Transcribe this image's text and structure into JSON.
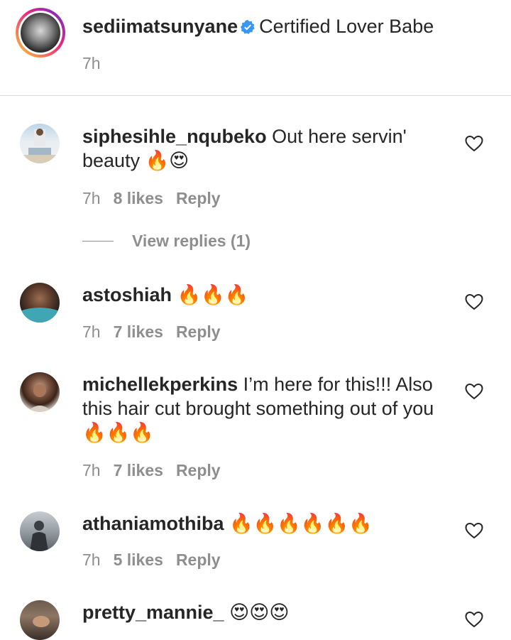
{
  "caption": {
    "username": "sediimatsunyane",
    "verified": true,
    "text": "Certified Lover Babe",
    "time": "7h"
  },
  "comments": [
    {
      "username": "siphesihle_nqubeko",
      "text": "Out here servin' beauty 🔥😍",
      "time": "7h",
      "likes": "8 likes",
      "reply": "Reply",
      "view_replies": "View replies (1)"
    },
    {
      "username": "astoshiah",
      "text": "🔥🔥🔥",
      "time": "7h",
      "likes": "7 likes",
      "reply": "Reply"
    },
    {
      "username": "michellekperkins",
      "text": "I’m here for this!!! Also this hair cut brought something out of you 🔥🔥🔥",
      "time": "7h",
      "likes": "7 likes",
      "reply": "Reply"
    },
    {
      "username": "athaniamothiba",
      "text": "🔥🔥🔥🔥🔥🔥",
      "time": "7h",
      "likes": "5 likes",
      "reply": "Reply"
    },
    {
      "username": "pretty_mannie_",
      "text": "😍😍😍"
    }
  ],
  "icons": {
    "heart": "heart-outline-icon",
    "verified": "verified-badge-icon"
  },
  "colors": {
    "text": "#262626",
    "secondary": "#8e8e8e",
    "verified": "#3897f0",
    "divider": "#dbdbdb"
  }
}
